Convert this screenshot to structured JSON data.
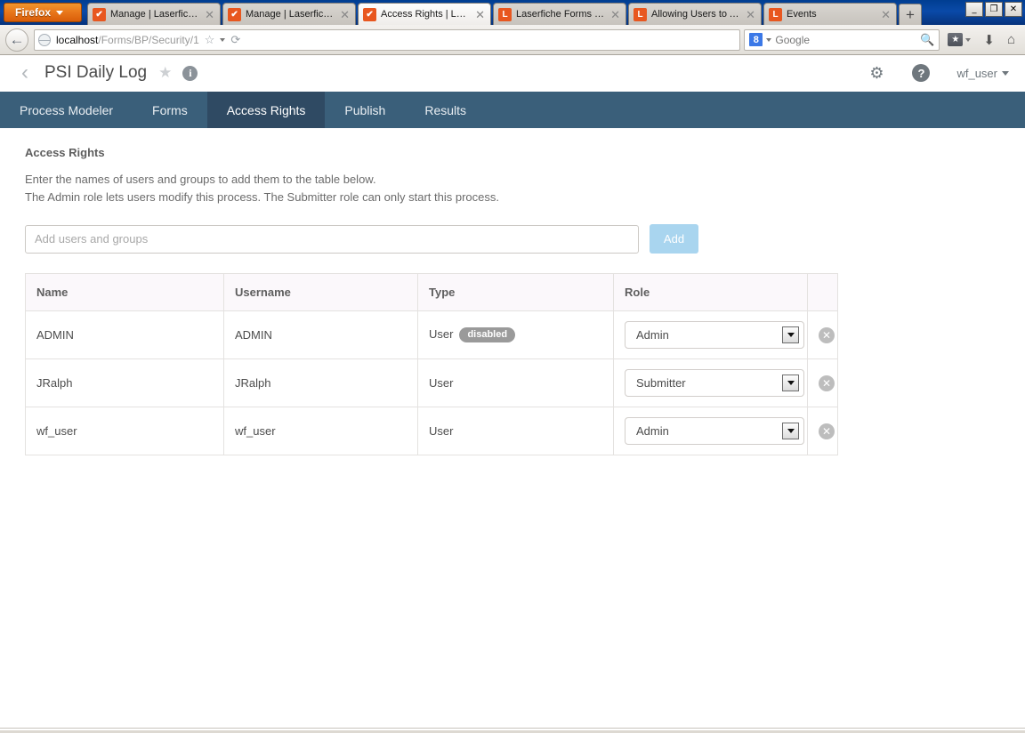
{
  "browser": {
    "app_button": "Firefox",
    "tabs": [
      {
        "title": "Manage | Laserfiche F...",
        "favicon": "laserfiche-check-icon",
        "selected": false
      },
      {
        "title": "Manage | Laserfiche F...",
        "favicon": "laserfiche-check-icon",
        "selected": false
      },
      {
        "title": "Access Rights | Laserf...",
        "favicon": "laserfiche-check-icon",
        "selected": true
      },
      {
        "title": "Laserfiche Forms Help",
        "favicon": "laserfiche-l-icon",
        "selected": false
      },
      {
        "title": "Allowing Users to Acc...",
        "favicon": "laserfiche-l-icon",
        "selected": false
      },
      {
        "title": "Events",
        "favicon": "laserfiche-l-icon",
        "selected": false
      }
    ],
    "new_tab_label": "+",
    "window_controls": {
      "minimize": "_",
      "restore": "❐",
      "close": "✕"
    },
    "url_host": "localhost",
    "url_path": "/Forms/BP/Security/1",
    "search_engine": "Google",
    "search_engine_badge": "8",
    "back_arrow": "←",
    "reload_glyph": "⟳",
    "star_glyph": "☆",
    "download_glyph": "⬇",
    "home_glyph": "⌂"
  },
  "app_header": {
    "back_chevron": "‹",
    "title": "PSI Daily Log",
    "star": "★",
    "info": "i",
    "gear": "✷",
    "help": "?",
    "user": "wf_user"
  },
  "nav_tabs": [
    {
      "label": "Process Modeler",
      "active": false
    },
    {
      "label": "Forms",
      "active": false
    },
    {
      "label": "Access Rights",
      "active": true
    },
    {
      "label": "Publish",
      "active": false
    },
    {
      "label": "Results",
      "active": false
    }
  ],
  "content": {
    "section_title": "Access Rights",
    "description_line1": "Enter the names of users and groups to add them to the table below.",
    "description_line2": "The Admin role lets users modify this process. The Submitter role can only start this process.",
    "add_placeholder": "Add users and groups",
    "add_value": "",
    "add_button_label": "Add"
  },
  "table": {
    "headers": [
      "Name",
      "Username",
      "Type",
      "Role",
      ""
    ],
    "rows": [
      {
        "name": "ADMIN",
        "username": "ADMIN",
        "type": "User",
        "badge": "disabled",
        "role": "Admin",
        "remove": "✕"
      },
      {
        "name": "JRalph",
        "username": "JRalph",
        "type": "User",
        "badge": "",
        "role": "Submitter",
        "remove": "✕"
      },
      {
        "name": "wf_user",
        "username": "wf_user",
        "type": "User",
        "badge": "",
        "role": "Admin",
        "remove": "✕"
      }
    ],
    "role_options": [
      "Admin",
      "Submitter"
    ]
  },
  "colors": {
    "nav_bar": "#3a5f7a",
    "nav_tab_active": "#2f4a63",
    "add_button": "#a9d5ef",
    "badge": "#9a9a9a",
    "table_header_bg": "#fbf8fb"
  }
}
